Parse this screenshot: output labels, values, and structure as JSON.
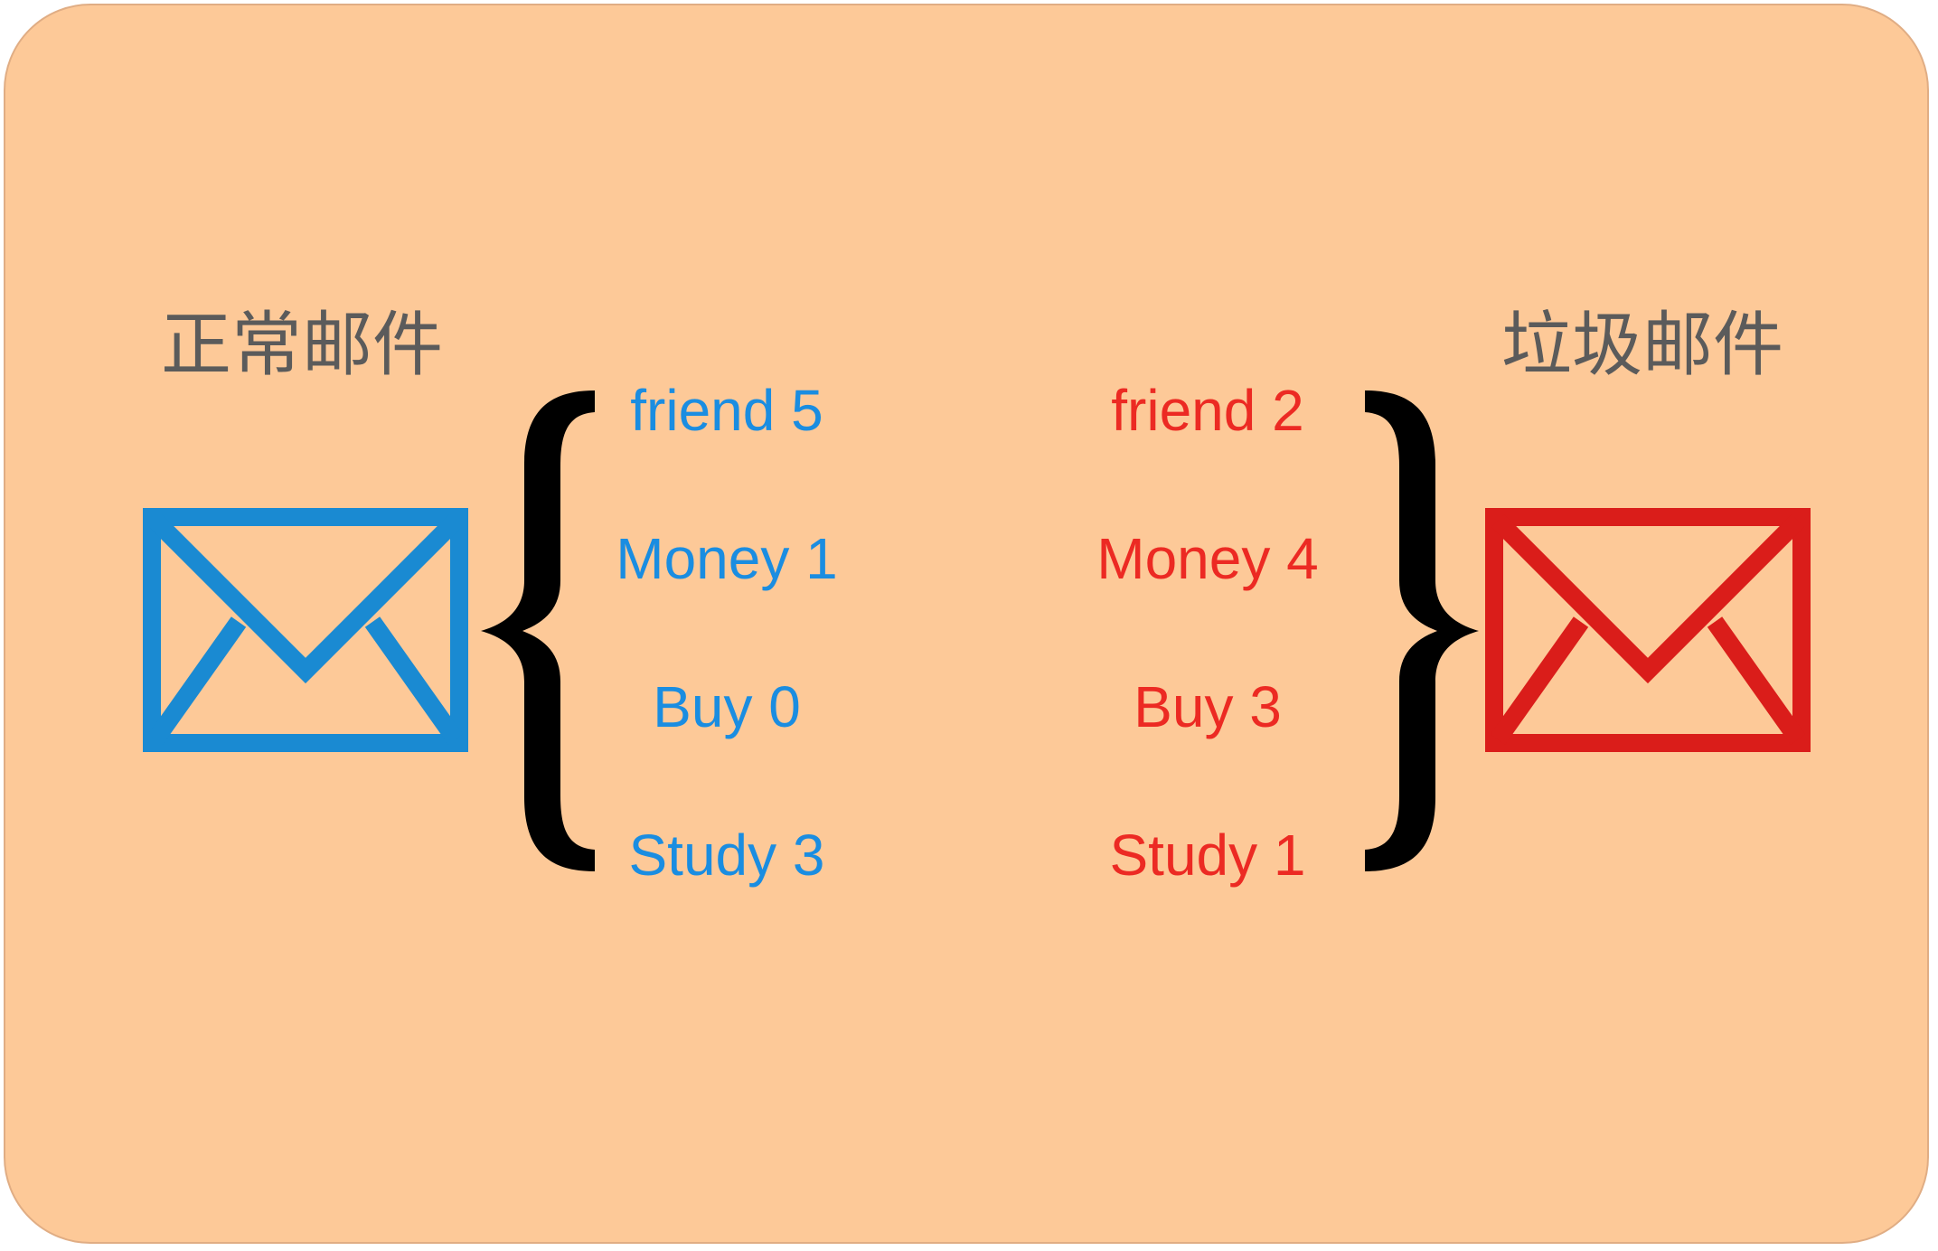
{
  "colors": {
    "background": "#fdc998",
    "ham": "#1a8de1",
    "spam": "#ec2a23",
    "ham_icon": "#1a8ad2",
    "spam_icon": "#da1d1a",
    "title": "#5b5b5b",
    "brace": "#000000"
  },
  "ham": {
    "title": "正常邮件",
    "icon": "envelope-icon",
    "words": [
      {
        "word": "friend",
        "count": 5,
        "label": "friend 5"
      },
      {
        "word": "Money",
        "count": 1,
        "label": "Money 1"
      },
      {
        "word": "Buy",
        "count": 0,
        "label": "Buy 0"
      },
      {
        "word": "Study",
        "count": 3,
        "label": "Study 3"
      }
    ]
  },
  "spam": {
    "title": "垃圾邮件",
    "icon": "envelope-icon",
    "words": [
      {
        "word": "friend",
        "count": 2,
        "label": "friend 2"
      },
      {
        "word": "Money",
        "count": 4,
        "label": "Money 4"
      },
      {
        "word": "Buy",
        "count": 3,
        "label": "Buy 3"
      },
      {
        "word": "Study",
        "count": 1,
        "label": "Study 1"
      }
    ]
  }
}
